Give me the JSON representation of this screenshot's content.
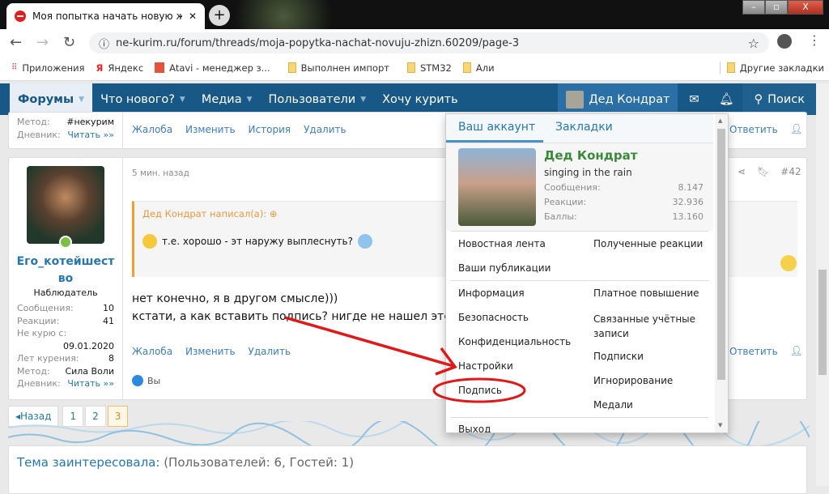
{
  "browser": {
    "tab_title": "Моя попытка начать новую жи",
    "url": "ne-kurim.ru/forum/threads/moja-popytka-nachat-novuju-zhizn.60209/page-3",
    "bookmarks": [
      "Приложения",
      "Яндекс",
      "Atavi - менеджер з...",
      "Выполнен импорт",
      "STM32",
      "Али"
    ],
    "other_bookmarks": "Другие закладки"
  },
  "navbar": {
    "items": [
      "Форумы",
      "Что нового?",
      "Медиа",
      "Пользователи",
      "Хочу курить"
    ],
    "user": "Дед Кондрат",
    "search": "Поиск"
  },
  "prev_post": {
    "stats": [
      {
        "label": "Метод:",
        "value": "#некурим"
      },
      {
        "label": "Дневник:",
        "value": "Читать »»"
      }
    ],
    "actions": [
      "Жалоба",
      "Изменить",
      "История",
      "Удалить"
    ],
    "reply": "Ответить"
  },
  "post": {
    "time": "5 мин. назад",
    "number": "#42",
    "author": "Его_котейшество",
    "role": "Наблюдатель",
    "stats": [
      {
        "label": "Сообщения:",
        "value": "10"
      },
      {
        "label": "Реакции:",
        "value": "41"
      },
      {
        "label": "Не курю с:",
        "value": ""
      },
      {
        "label": "",
        "value": "09.01.2020"
      },
      {
        "label": "Лет курения:",
        "value": "8"
      },
      {
        "label": "Метод:",
        "value": "Сила Воли"
      },
      {
        "label": "Дневник:",
        "value": "Читать »»"
      }
    ],
    "quote_author": "Дед Кондрат написал(а):",
    "quote_text": "т.е. хорошо - эт наружу выплеснуть?",
    "body": [
      "нет конечно, я в другом смысле)))",
      "кстати, а как вставить подпись? нигде не нашел этой"
    ],
    "actions": [
      "Жалоба",
      "Изменить",
      "Удалить"
    ],
    "reply": "Ответить",
    "likes": "Вы"
  },
  "pagination": {
    "prev": "◂Назад",
    "pages": [
      "1",
      "2",
      "3"
    ],
    "current": "3"
  },
  "footer": {
    "title": "Тема заинтересовала:",
    "counts": "(Пользователей: 6, Гостей: 1)"
  },
  "dropdown": {
    "tabs": [
      "Ваш аккаунт",
      "Закладки"
    ],
    "name": "Дед Кондрат",
    "status": "singing in the rain",
    "stats": [
      {
        "label": "Сообщения:",
        "value": "8.147"
      },
      {
        "label": "Реакции:",
        "value": "32.936"
      },
      {
        "label": "Баллы:",
        "value": "13.160"
      }
    ],
    "left1": [
      "Новостная лента",
      "Ваши публикации"
    ],
    "right1": [
      "Полученные реакции"
    ],
    "left2": [
      "Информация",
      "Безопасность",
      "Конфиденциальность",
      "Настройки",
      "Подпись"
    ],
    "right2": [
      "Платное повышение",
      "Связанные учётные записи",
      "Подписки",
      "Игнорирование",
      "Медали"
    ],
    "logout": "Выход"
  }
}
